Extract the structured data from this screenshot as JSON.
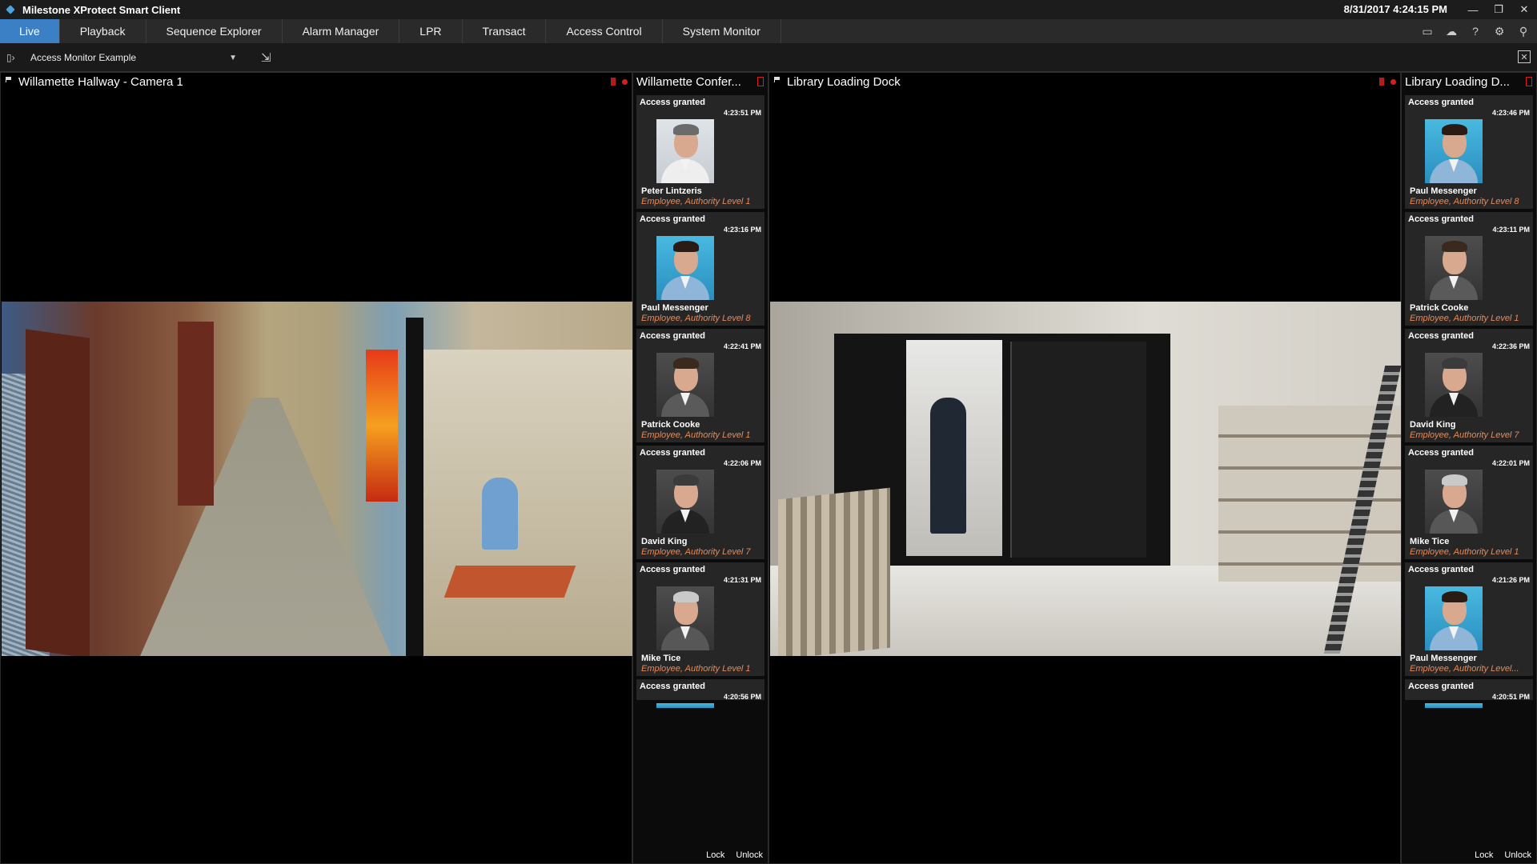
{
  "titlebar": {
    "app_title": "Milestone XProtect Smart Client",
    "datetime": "8/31/2017 4:24:15 PM",
    "minimize": "—",
    "restore": "❐",
    "close": "✕"
  },
  "tabs": [
    {
      "label": "Live",
      "active": true
    },
    {
      "label": "Playback"
    },
    {
      "label": "Sequence Explorer"
    },
    {
      "label": "Alarm Manager"
    },
    {
      "label": "LPR"
    },
    {
      "label": "Transact"
    },
    {
      "label": "Access Control"
    },
    {
      "label": "System Monitor"
    }
  ],
  "toolbar_icons": [
    "monitor-icon",
    "cloud-icon",
    "help-icon",
    "gear-icon",
    "pin-icon"
  ],
  "viewbar": {
    "view_name": "Access Monitor Example",
    "caret": "▼",
    "setup": "⇲",
    "fullscreen": "⤢"
  },
  "cameras": [
    {
      "title": "Willamette Hallway - Camera 1",
      "scene": "hallway"
    },
    {
      "title": "Library Loading Dock",
      "scene": "loading-dock"
    }
  ],
  "access_panels": [
    {
      "title": "Willamette Confer...",
      "events": [
        {
          "status": "Access granted",
          "time": "4:23:51 PM",
          "name": "Peter Lintzeris",
          "role": "Employee, Authority Level 1",
          "photo_bg": "light",
          "shirt": "#eeeeee",
          "hair": "#6b6b6b"
        },
        {
          "status": "Access granted",
          "time": "4:23:16 PM",
          "name": "Paul Messenger",
          "role": "Employee, Authority Level 8",
          "photo_bg": "cyan",
          "shirt": "#8fb6d9",
          "hair": "#2a1c14"
        },
        {
          "status": "Access granted",
          "time": "4:22:41 PM",
          "name": "Patrick Cooke",
          "role": "Employee, Authority Level 1",
          "photo_bg": "gray",
          "shirt": "#5a5a5a",
          "hair": "#3a2a1e"
        },
        {
          "status": "Access granted",
          "time": "4:22:06 PM",
          "name": "David King",
          "role": "Employee, Authority Level 7",
          "photo_bg": "gray",
          "shirt": "#222222",
          "hair": "#3b3b3b"
        },
        {
          "status": "Access granted",
          "time": "4:21:31 PM",
          "name": "Mike Tice",
          "role": "Employee, Authority Level 1",
          "photo_bg": "gray",
          "shirt": "#575757",
          "hair": "#c9c9c9"
        },
        {
          "status": "Access granted",
          "time": "4:20:56 PM",
          "partial": true
        }
      ],
      "lock": "Lock",
      "unlock": "Unlock"
    },
    {
      "title": "Library Loading D...",
      "events": [
        {
          "status": "Access granted",
          "time": "4:23:46 PM",
          "name": "Paul Messenger",
          "role": "Employee, Authority Level 8",
          "photo_bg": "cyan",
          "shirt": "#8fb6d9",
          "hair": "#2a1c14"
        },
        {
          "status": "Access granted",
          "time": "4:23:11 PM",
          "name": "Patrick Cooke",
          "role": "Employee, Authority Level 1",
          "photo_bg": "gray",
          "shirt": "#5a5a5a",
          "hair": "#3a2a1e"
        },
        {
          "status": "Access granted",
          "time": "4:22:36 PM",
          "name": "David King",
          "role": "Employee, Authority Level 7",
          "photo_bg": "gray",
          "shirt": "#222222",
          "hair": "#3b3b3b"
        },
        {
          "status": "Access granted",
          "time": "4:22:01 PM",
          "name": "Mike Tice",
          "role": "Employee, Authority Level 1",
          "photo_bg": "gray",
          "shirt": "#575757",
          "hair": "#c9c9c9"
        },
        {
          "status": "Access granted",
          "time": "4:21:26 PM",
          "name": "Paul Messenger",
          "role": "Employee, Authority Level...",
          "photo_bg": "cyan",
          "shirt": "#8fb6d9",
          "hair": "#2a1c14"
        },
        {
          "status": "Access granted",
          "time": "4:20:51 PM",
          "partial": true
        }
      ],
      "lock": "Lock",
      "unlock": "Unlock"
    }
  ],
  "colors": {
    "accent_tab": "#3b7fc4",
    "role_text": "#e88a56",
    "recording": "#d42020"
  }
}
